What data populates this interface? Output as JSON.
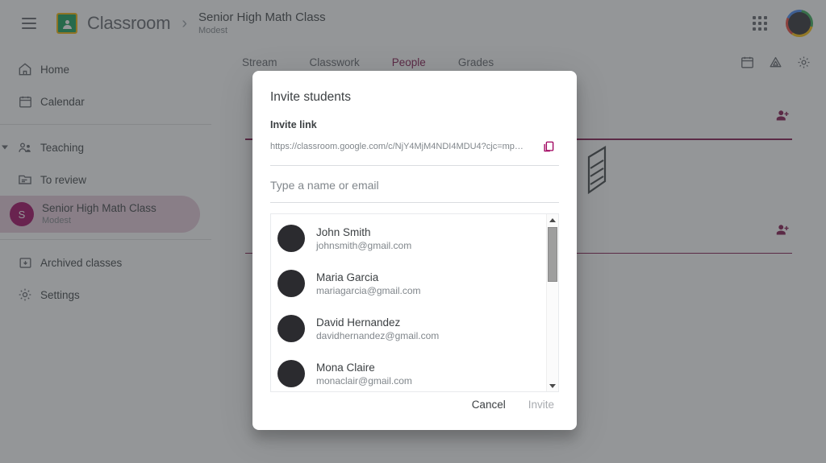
{
  "header": {
    "menu_icon": "hamburger-icon",
    "logo_icon": "classroom-logo-icon",
    "logo_text": "Classroom",
    "breadcrumb_separator": "›",
    "class_title": "Senior High Math Class",
    "class_subtitle": "Modest",
    "apps_icon": "apps-grid-icon",
    "avatar_icon": "account-avatar"
  },
  "sidebar": {
    "items": [
      {
        "label": "Home",
        "icon": "home-icon",
        "name": "sidebar-item-home"
      },
      {
        "label": "Calendar",
        "icon": "calendar-icon",
        "name": "sidebar-item-calendar"
      },
      {
        "label": "Teaching",
        "icon": "teaching-people-icon",
        "name": "sidebar-item-teaching"
      },
      {
        "label": "To review",
        "icon": "to-review-icon",
        "name": "sidebar-item-to-review"
      },
      {
        "label": "Archived classes",
        "icon": "archive-icon",
        "name": "sidebar-item-archived-classes"
      },
      {
        "label": "Settings",
        "icon": "gear-icon",
        "name": "sidebar-item-settings"
      }
    ],
    "active_class": {
      "initial": "S",
      "name": "Senior High Math Class",
      "subtitle": "Modest",
      "avatar_color": "#a0005e",
      "highlight_color": "#e6c9d9"
    }
  },
  "tabs": [
    {
      "label": "Stream",
      "active": false
    },
    {
      "label": "Classwork",
      "active": false
    },
    {
      "label": "People",
      "active": true
    },
    {
      "label": "Grades",
      "active": false
    }
  ],
  "tab_actions": [
    {
      "icon": "calendar-icon",
      "name": "calendar-action"
    },
    {
      "icon": "drive-icon",
      "name": "drive-action"
    },
    {
      "icon": "gear-icon",
      "name": "class-settings-action"
    }
  ],
  "people_page": {
    "invite_icon": "person-add-icon",
    "accent_color": "#80104a"
  },
  "dialog": {
    "title": "Invite students",
    "link_label": "Invite link",
    "link_url": "https://classroom.google.com/c/NjY4MjM4NDI4MDU4?cjc=mp…",
    "copy_icon": "copy-icon",
    "search_placeholder": "Type a name or email",
    "search_value": "",
    "people": [
      {
        "name": "John Smith",
        "email": "johnsmith@gmail.com"
      },
      {
        "name": "Maria Garcia",
        "email": "mariagarcia@gmail.com"
      },
      {
        "name": "David Hernandez",
        "email": "davidhernandez@gmail.com"
      },
      {
        "name": "Mona Claire",
        "email": "monaclair@gmail.com"
      }
    ],
    "cancel_label": "Cancel",
    "invite_label": "Invite",
    "invite_disabled": true
  },
  "colors": {
    "accent": "#80104a",
    "brand_pink": "#a0005e",
    "scrim": "rgba(60,64,67,0.55)"
  }
}
